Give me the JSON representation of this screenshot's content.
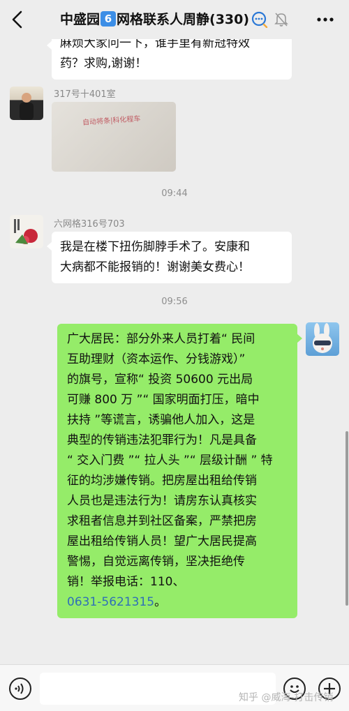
{
  "header": {
    "title_prefix": "中盛园",
    "title_icon": "6",
    "title_suffix": "网格联系人周静(330)",
    "icons": [
      "back-arrow-icon",
      "chat-search-icon",
      "mute-bell-icon",
      "more-icon"
    ]
  },
  "messages": [
    {
      "type": "text",
      "side": "left",
      "text_line1": "麻烦大家问一下，谁手里有新冠特效",
      "text_line2": "药？求购,谢谢！"
    },
    {
      "type": "image",
      "side": "left",
      "sender": "317号十401室",
      "image_text": "自动将条|科化程车"
    },
    {
      "type": "time",
      "text": "09:44"
    },
    {
      "type": "text",
      "side": "left",
      "sender": "六网格316号703",
      "text_line1": "我是在楼下扭伤脚脖手术了。安康和",
      "text_line2": "大病都不能报销的！谢谢美女费心！"
    },
    {
      "type": "time",
      "text": "09:56"
    },
    {
      "type": "text",
      "side": "right",
      "lines": [
        "广大居民：部分外来人员打着“ 民间",
        "互助理财（资本运作、分钱游戏）”",
        "的旗号，宣称“ 投资 50600 元出局",
        "可赚 800 万 ”“ 国家明面打压，暗中",
        "扶持 ”等谎言，诱骗他人加入，这是",
        "典型的传销违法犯罪行为！凡是具备",
        "“ 交入门费 ”“ 拉人头 ”“ 层级计酬 ” 特",
        "征的均涉嫌传销。把房屋出租给传销",
        "人员也是违法行为！请房东认真核实",
        "求租者信息并到社区备案，严禁把房",
        "屋出租给传销人员！望广大居民提高",
        "警惕，自觉远离传销，坚决拒绝传",
        "销！举报电话：110、"
      ],
      "phone": "0631-5621315",
      "phone_suffix": "。"
    }
  ],
  "bottom_bar": {
    "icons": [
      "voice-icon",
      "emoji-icon",
      "plus-icon"
    ],
    "watermark": "知乎 @威海-打击传销"
  }
}
